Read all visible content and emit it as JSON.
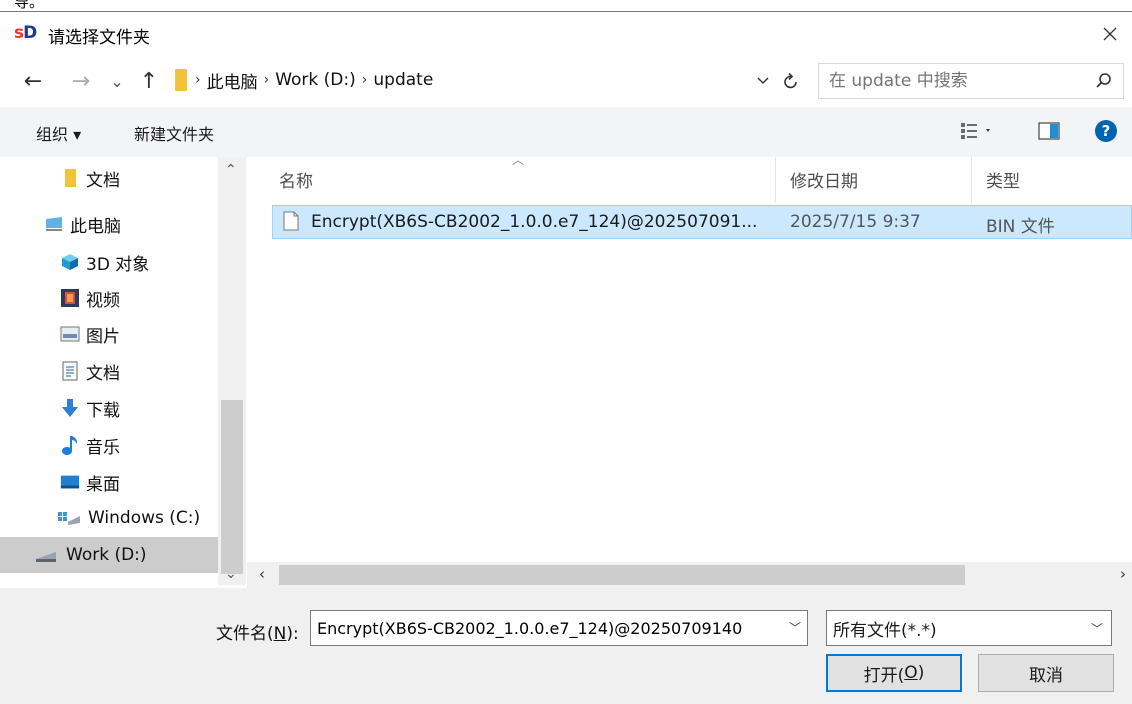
{
  "fragment": "导。",
  "window": {
    "title": "请选择文件夹",
    "logo_s": "s",
    "logo_d": "D"
  },
  "nav_buttons": {
    "back": "←",
    "forward": "→",
    "recent": "⌄",
    "up": "↑"
  },
  "breadcrumb": [
    "此电脑",
    "Work (D:)",
    "update"
  ],
  "search": {
    "placeholder": "在 update 中搜索"
  },
  "toolbar": {
    "organize": "组织 ▾",
    "new_folder": "新建文件夹"
  },
  "sidebar": {
    "items": [
      {
        "label": "文档",
        "icon": "folder-icon"
      },
      {
        "label": "此电脑",
        "icon": "computer-icon"
      },
      {
        "label": "3D 对象",
        "icon": "3d-objects-icon"
      },
      {
        "label": "视频",
        "icon": "video-icon"
      },
      {
        "label": "图片",
        "icon": "pictures-icon"
      },
      {
        "label": "文档",
        "icon": "documents-icon"
      },
      {
        "label": "下载",
        "icon": "download-icon"
      },
      {
        "label": "音乐",
        "icon": "music-icon"
      },
      {
        "label": "桌面",
        "icon": "desktop-icon"
      },
      {
        "label": "Windows (C:)",
        "icon": "system-drive-icon"
      },
      {
        "label": "Work (D:)",
        "icon": "drive-icon",
        "selected": true
      }
    ]
  },
  "columns": {
    "name": "名称",
    "modified": "修改日期",
    "type": "类型"
  },
  "files": [
    {
      "name": "Encrypt(XB6S-CB2002_1.0.0.e7_124)@202507091...",
      "modified": "2025/7/15 9:37",
      "type": "BIN 文件"
    }
  ],
  "footer": {
    "filename_label_pre": "文件名(",
    "filename_label_key": "N",
    "filename_label_post": "):",
    "filename_value": "Encrypt(XB6S-CB2002_1.0.0.e7_124)@20250709140",
    "filetype": "所有文件(*.*)",
    "open_pre": "打开(",
    "open_key": "O",
    "open_post": ")",
    "cancel": "取消"
  },
  "colors": {
    "selection_bg": "#cce8ff",
    "selection_border": "#99d1ff",
    "accent": "#0078d7",
    "help": "#0063b1"
  }
}
